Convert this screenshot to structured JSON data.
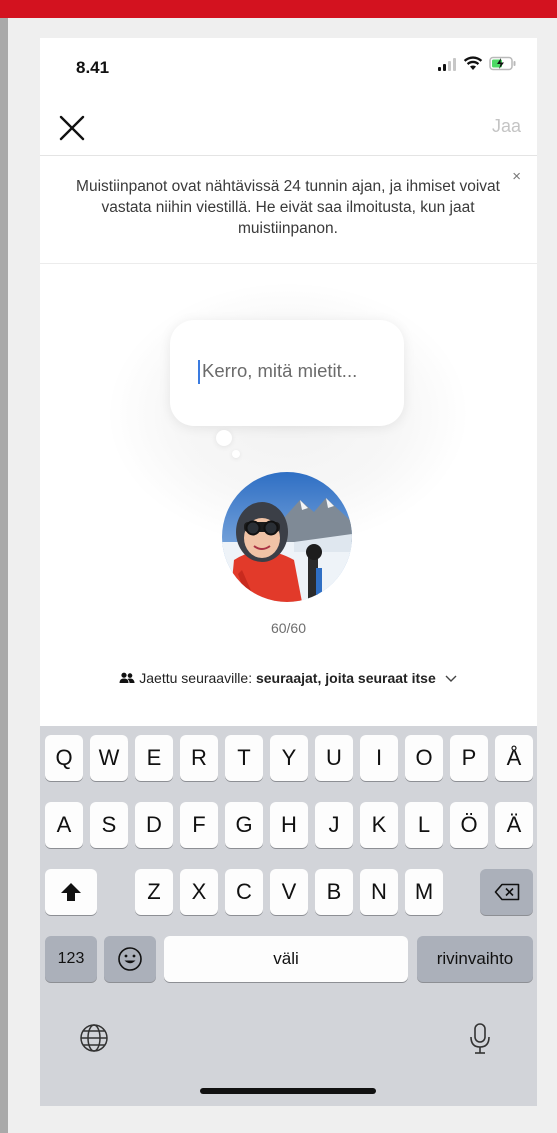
{
  "status_bar": {
    "time": "8.41",
    "icons": [
      "signal-icon",
      "wifi-icon",
      "battery-charging-icon"
    ]
  },
  "nav": {
    "close_icon": "close-icon",
    "share_label": "Jaa"
  },
  "info_banner": {
    "text": "Muistiinpanot ovat nähtävissä 24 tunnin ajan, ja ihmiset voivat vastata niihin viestillä. He eivät saa ilmoitusta, kun jaat muistiinpanon.",
    "close_label": "×"
  },
  "note": {
    "placeholder": "Kerro, mitä mietit...",
    "char_count": "60/60"
  },
  "audience": {
    "prefix": "Jaettu seuraaville: ",
    "value": "seuraajat, joita seuraat itse",
    "icon": "people-icon",
    "chevron": "chevron-down-icon"
  },
  "keyboard": {
    "row1": [
      "Q",
      "W",
      "E",
      "R",
      "T",
      "Y",
      "U",
      "I",
      "O",
      "P",
      "Å"
    ],
    "row2": [
      "A",
      "S",
      "D",
      "F",
      "G",
      "H",
      "J",
      "K",
      "L",
      "Ö",
      "Ä"
    ],
    "row3": [
      "Z",
      "X",
      "C",
      "V",
      "B",
      "N",
      "M"
    ],
    "numbers_label": "123",
    "space_label": "väli",
    "return_label": "rivinvaihto"
  },
  "colors": {
    "accent_red": "#d3121f",
    "caret": "#3a7be0",
    "keyboard_bg": "#d2d4d9"
  }
}
